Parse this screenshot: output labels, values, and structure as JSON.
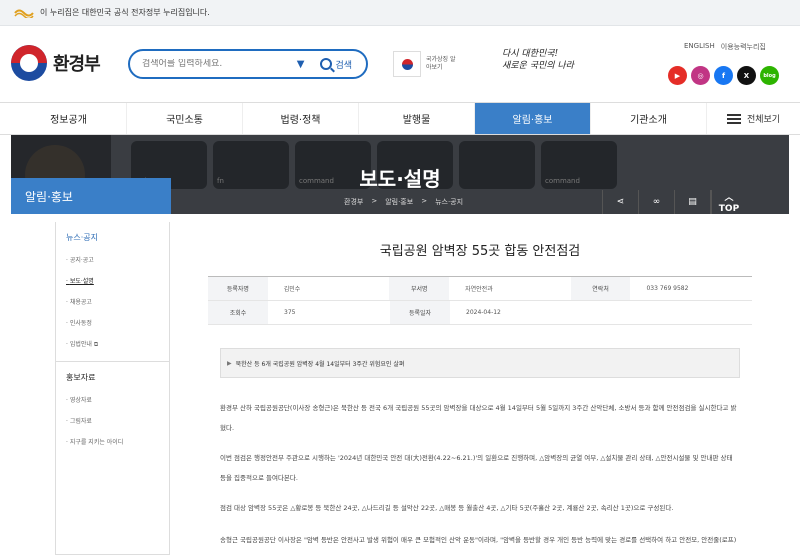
{
  "gov_banner": {
    "text": "이 누리집은 대한민국 공식 전자정부 누리집입니다."
  },
  "header": {
    "logo_text": "환경부",
    "search": {
      "placeholder": "검색어를 입력하세요.",
      "button_label": "검색"
    },
    "flag_label": "국가상징 알아보기",
    "slogan_line1": "다시 대한민국!",
    "slogan_line2": "새로운 국민의 나라",
    "utils": [
      "ENGLISH",
      "이용능력누리집"
    ],
    "sns": [
      {
        "name": "youtube",
        "label": "▶",
        "color": "#e52d27"
      },
      {
        "name": "instagram",
        "label": "◎",
        "color": "#c13584"
      },
      {
        "name": "facebook",
        "label": "f",
        "color": "#1877f2"
      },
      {
        "name": "x",
        "label": "X",
        "color": "#111111"
      },
      {
        "name": "blog",
        "label": "blog",
        "color": "#2db400"
      }
    ]
  },
  "nav": {
    "items": [
      "정보공개",
      "국민소통",
      "법령·정책",
      "발행물",
      "알림·홍보",
      "기관소개"
    ],
    "active_index": 4,
    "all_label": "전체보기"
  },
  "hero": {
    "title": "보도·설명",
    "keys": [
      "ctrl",
      "fn",
      "command",
      "",
      "",
      "command",
      "",
      ""
    ],
    "breadcrumb": [
      "환경부",
      ">",
      "알림·홍보",
      ">",
      "뉴스·공지"
    ]
  },
  "side_tab": "알림·홍보",
  "tools": {
    "top_label": "TOP"
  },
  "sidebar": {
    "section1": "뉴스·공지",
    "section1_items": [
      "공지·공고",
      "보도·설명",
      "채용공고",
      "인사동정",
      "입법안내"
    ],
    "section1_active": 1,
    "section2": "홍보자료",
    "section2_items": [
      "영상자료",
      "그림자료",
      "지구를 지키는 아이디"
    ]
  },
  "article": {
    "title": "국립공원 암벽장 55곳 합동 안전점검",
    "meta": {
      "row1": [
        [
          "등록자명",
          "김민수"
        ],
        [
          "부서명",
          "자연안전과"
        ],
        [
          "연락처",
          "033 769 9582"
        ]
      ],
      "row2": [
        [
          "조회수",
          "375"
        ],
        [
          "등록일자",
          "2024-04-12"
        ]
      ]
    },
    "summary": "북한산 등 6개 국립공원 암벽장 4월 14일부터 3주간 위험요인 살펴",
    "paragraphs": [
      "환경부 산하 국립공원공단(이사장 송형근)은 북한산 등 전국 6개 국립공원 55곳의 암벽장을 대상으로 4월 14일부터 5월 5일까지 3주간 산악단체, 소방서 등과 함께 안전점검을 실시한다고 밝혔다.",
      "이번 점검은 행정안전부 주관으로 시행하는 '2024년 대한민국 안전 대(大)전환(4.22~6.21.)'의 일환으로 진행하며, △암벽장의 균열 여부, △설치물 관리 상태, △안전시설물 및 안내판 상태 등을 집중적으로 들여다본다.",
      "점검 대상 암벽장 55곳은 △황로봉 등 북한산 24곳, △나드리길 등 설악산 22곳, △매봉 등 월출산 4곳, △기타 5곳(주흘산 2곳, 계룡산 2곳, 속리산 1곳)으로 구성된다.",
      "송형근 국립공원공단 이사장은 \"암벽 등반은 안전사고 발생 위험이 매우 큰 모험적인 산악 운동\"이라며, \"암벽을 등반할 경우 개인 등반 능력에 맞는 경로를 선택하여 하고 안전모, 안전줄(로프) 등 안전장비를 반드시 착용해야 한다\"라고 밝혔다."
    ]
  }
}
